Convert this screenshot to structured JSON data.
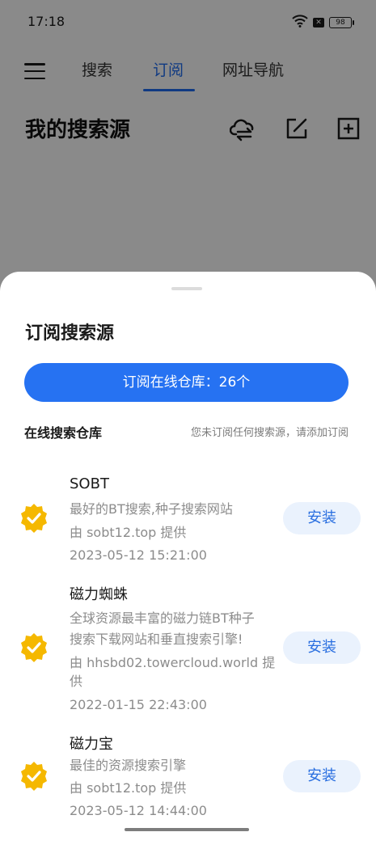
{
  "status": {
    "time": "17:18",
    "battery": "98"
  },
  "tabs": [
    {
      "label": "搜索"
    },
    {
      "label": "订阅"
    },
    {
      "label": "网址导航"
    }
  ],
  "page": {
    "title": "我的搜索源"
  },
  "sheet": {
    "title": "订阅搜索源",
    "subscribe_button": "订阅在线仓库：26个",
    "repo_label": "在线搜索仓库",
    "repo_hint": "您未订阅任何搜索源，请添加订阅",
    "install_label": "安装",
    "items": [
      {
        "name": "SOBT",
        "desc": [
          "最好的BT搜索,种子搜索网站"
        ],
        "provider": [
          "由 sobt12.top 提供"
        ],
        "date": "2023-05-12 15:21:00"
      },
      {
        "name": "磁力蜘蛛",
        "desc": [
          "全球资源最丰富的磁力链BT种子",
          "搜索下载网站和垂直搜索引擎!"
        ],
        "provider": [
          "由 hhsbd02.towercloud.world 提",
          "供"
        ],
        "date": "2022-01-15 22:43:00"
      },
      {
        "name": "磁力宝",
        "desc": [
          "最佳的资源搜索引擎"
        ],
        "provider": [
          "由 sobt12.top 提供"
        ],
        "date": "2023-05-12 14:44:00"
      }
    ]
  },
  "colors": {
    "accent": "#2672f2",
    "check": "#f5b800",
    "install_bg": "#eaf2fd"
  },
  "icons": {
    "wifi": "wifi-icon",
    "sim": "sim-off-icon",
    "menu": "menu-icon",
    "sync": "cloud-sync-icon",
    "edit": "edit-icon",
    "add": "add-box-icon",
    "verified": "verified-badge-icon"
  }
}
